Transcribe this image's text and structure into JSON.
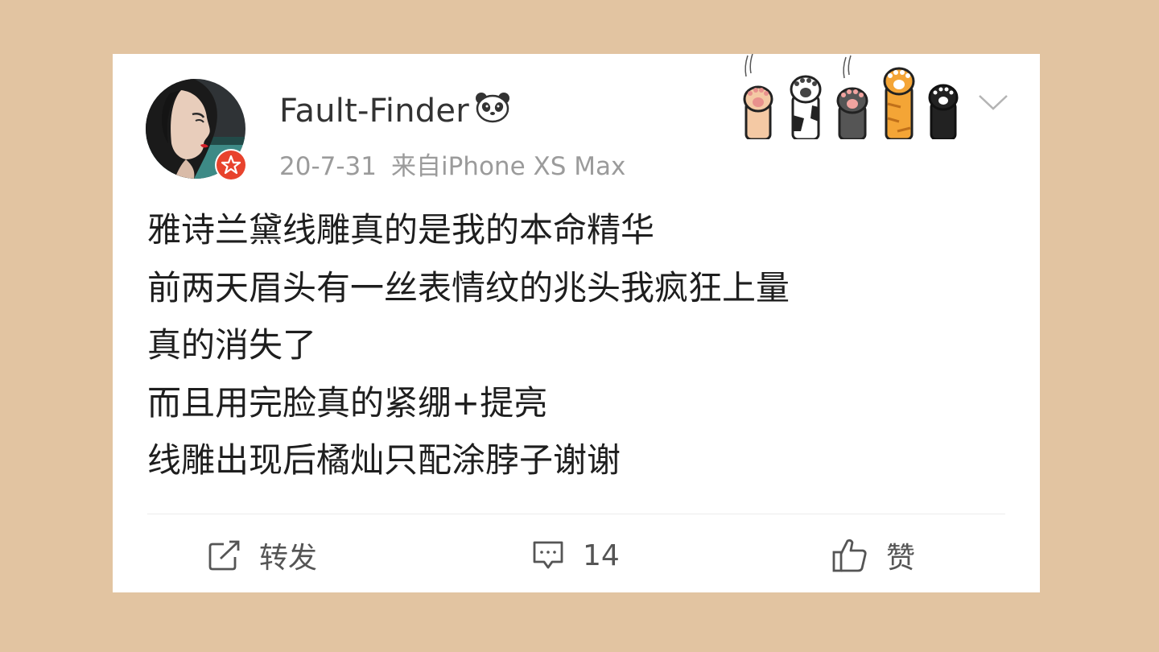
{
  "post": {
    "username": "Fault-Finder",
    "date": "20-7-31",
    "source": "来自iPhone XS Max",
    "icons": {
      "avatar": "avatar-illustration",
      "verified_badge": "red-star-badge-icon",
      "name_emoji": "panda-icon",
      "decoration": "cat-paws-icon",
      "menu": "chevron-down-icon"
    },
    "content_lines": [
      "雅诗兰黛线雕真的是我的本命精华",
      "前两天眉头有一丝表情纹的兆头我疯狂上量",
      "真的消失了",
      "而且用完脸真的紧绷+提亮",
      "线雕出现后橘灿只配涂脖子谢谢"
    ]
  },
  "actions": {
    "repost": {
      "label": "转发",
      "icon": "repost-icon"
    },
    "comment": {
      "label": "14",
      "icon": "comment-icon"
    },
    "like": {
      "label": "赞",
      "icon": "thumbs-up-icon"
    }
  },
  "colors": {
    "background": "#e2c4a1",
    "card": "#ffffff",
    "badge": "#e8432d",
    "meta_text": "#9b9b9b"
  }
}
